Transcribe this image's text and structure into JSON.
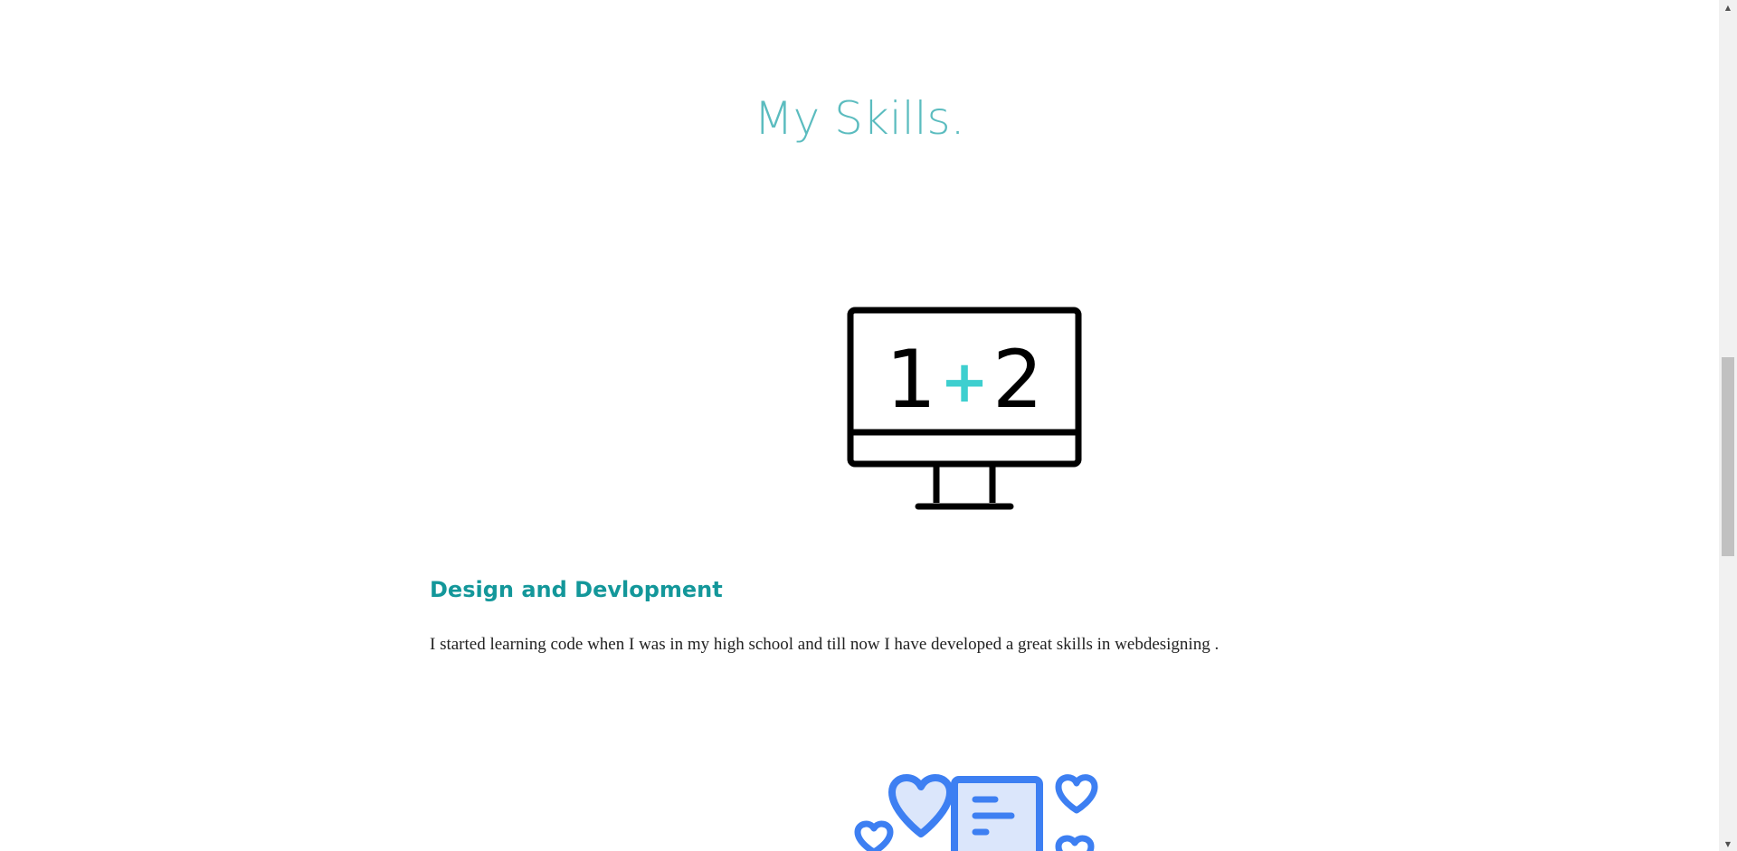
{
  "skills_section": {
    "title": "My Skills.",
    "items": [
      {
        "icon": "monitor-calculator-icon",
        "icon_text_left": "1",
        "icon_text_op": "+",
        "icon_text_right": "2",
        "heading": "Design and Devlopment",
        "description": "I started learning code when I was in my high school and till now I have developed a great skills in webdesigning ."
      },
      {
        "icon": "hearts-chat-icon"
      }
    ]
  },
  "colors": {
    "title": "#5bbcbf",
    "heading": "#13979a",
    "icon_accent": "#3ecfcf",
    "icon_blue": "#3d7ff2",
    "icon_blue_light": "#dbe6fb"
  },
  "scrollbar": {
    "up_icon": "triangle-up-icon",
    "down_icon": "triangle-down-icon"
  }
}
